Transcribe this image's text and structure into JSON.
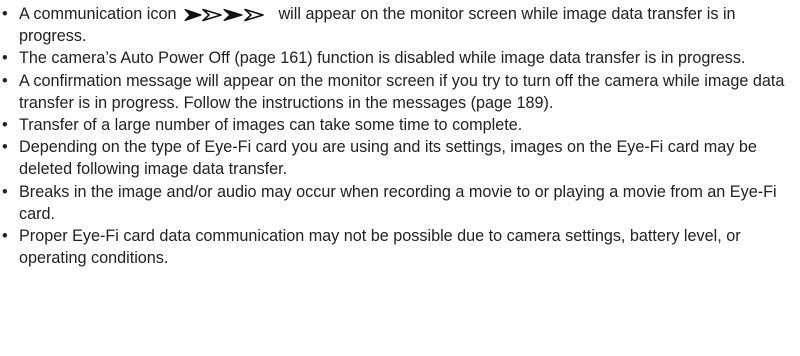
{
  "notes": {
    "bullet": "•",
    "items": [
      {
        "before": "A communication icon",
        "after": " will appear on the monitor screen while image data transfer is in progress."
      },
      {
        "text": "The camera’s Auto Power Off (page 161) function is disabled while image data transfer is in progress."
      },
      {
        "text": "A confirmation message will appear on the monitor screen if you try to turn off the camera while image data transfer is in progress. Follow the instructions in the messages (page 189)."
      },
      {
        "text": "Transfer of a large number of images can take some time to complete."
      },
      {
        "text": "Depending on the type of Eye-Fi card you are using and its settings, images on the Eye-Fi card may be deleted following image data transfer."
      },
      {
        "text": "Breaks in the image and/or audio may occur when recording a movie to or playing a movie from an Eye-Fi card."
      },
      {
        "text": "Proper Eye-Fi card data communication may not be possible due to camera settings, battery level, or operating conditions."
      }
    ]
  },
  "icons": {
    "communication_icon": "eye-fi-communication-icon",
    "icon_color": "#111111"
  }
}
